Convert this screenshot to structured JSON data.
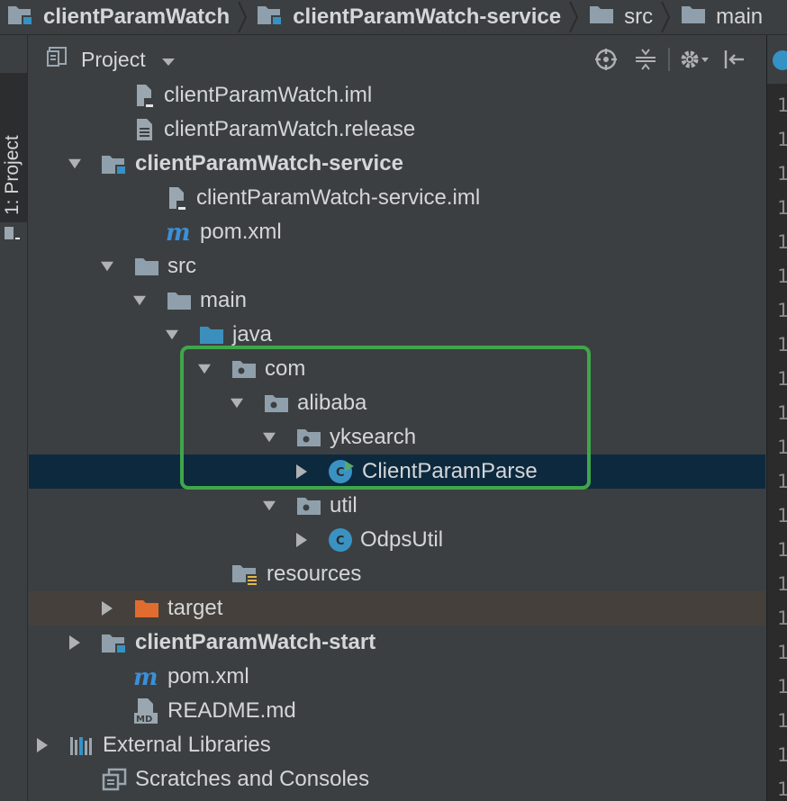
{
  "breadcrumb": {
    "items": [
      {
        "label": "clientParamWatch",
        "bold": true,
        "icon": "module-folder-icon"
      },
      {
        "label": "clientParamWatch-service",
        "bold": true,
        "icon": "module-folder-icon"
      },
      {
        "label": "src",
        "bold": false,
        "icon": "folder-icon"
      },
      {
        "label": "main",
        "bold": false,
        "icon": "folder-icon"
      }
    ]
  },
  "sidebar": {
    "tab_label": "1: Project"
  },
  "panel": {
    "title": "Project",
    "actions": [
      "locate-icon",
      "collapse-all-icon",
      "gear-icon",
      "hide-icon"
    ]
  },
  "tree": {
    "rows": [
      {
        "label": "clientParamWatch.iml",
        "indent": 2,
        "arrow": "none",
        "icon": "iml-file-icon",
        "bold": false
      },
      {
        "label": "clientParamWatch.release",
        "indent": 2,
        "arrow": "none",
        "icon": "text-file-icon",
        "bold": false
      },
      {
        "label": "clientParamWatch-service",
        "indent": 1,
        "arrow": "down",
        "icon": "module-folder-icon",
        "bold": true
      },
      {
        "label": "clientParamWatch-service.iml",
        "indent": 3,
        "arrow": "none",
        "icon": "iml-file-icon",
        "bold": false
      },
      {
        "label": "pom.xml",
        "indent": 3,
        "arrow": "none",
        "icon": "maven-icon",
        "bold": false
      },
      {
        "label": "src",
        "indent": 2,
        "arrow": "down",
        "icon": "folder-icon",
        "bold": false
      },
      {
        "label": "main",
        "indent": 3,
        "arrow": "down",
        "icon": "folder-icon",
        "bold": false
      },
      {
        "label": "java",
        "indent": 4,
        "arrow": "down",
        "icon": "source-folder-icon",
        "bold": false
      },
      {
        "label": "com",
        "indent": 5,
        "arrow": "down",
        "icon": "package-icon",
        "bold": false
      },
      {
        "label": "alibaba",
        "indent": 6,
        "arrow": "down",
        "icon": "package-icon",
        "bold": false
      },
      {
        "label": "yksearch",
        "indent": 7,
        "arrow": "down",
        "icon": "package-icon",
        "bold": false
      },
      {
        "label": "ClientParamParse",
        "indent": 8,
        "arrow": "right",
        "icon": "runnable-class-icon",
        "bold": false,
        "selected": true
      },
      {
        "label": "util",
        "indent": 7,
        "arrow": "down",
        "icon": "package-icon",
        "bold": false
      },
      {
        "label": "OdpsUtil",
        "indent": 8,
        "arrow": "right",
        "icon": "class-icon",
        "bold": false
      },
      {
        "label": "resources",
        "indent": 5,
        "arrow": "none",
        "icon": "resources-folder-icon",
        "bold": false
      },
      {
        "label": "target",
        "indent": 2,
        "arrow": "right",
        "icon": "excluded-folder-icon",
        "bold": false,
        "excluded": true
      },
      {
        "label": "clientParamWatch-start",
        "indent": 1,
        "arrow": "right",
        "icon": "module-folder-icon",
        "bold": true
      },
      {
        "label": "pom.xml",
        "indent": 2,
        "arrow": "none",
        "icon": "maven-icon",
        "bold": false
      },
      {
        "label": "README.md",
        "indent": 2,
        "arrow": "none",
        "icon": "markdown-file-icon",
        "bold": false
      },
      {
        "label": "External Libraries",
        "indent": 0,
        "arrow": "right",
        "icon": "libraries-icon",
        "bold": false
      },
      {
        "label": "Scratches and Consoles",
        "indent": 1,
        "arrow": "none",
        "icon": "scratches-icon",
        "bold": false
      }
    ]
  },
  "editor": {
    "line_numbers": [
      "1",
      "1",
      "1",
      "1",
      "1",
      "1",
      "1",
      "1",
      "1",
      "1",
      "1",
      "1",
      "1",
      "1",
      "1",
      "1",
      "1",
      "1",
      "1",
      "1",
      "1",
      "1"
    ]
  }
}
